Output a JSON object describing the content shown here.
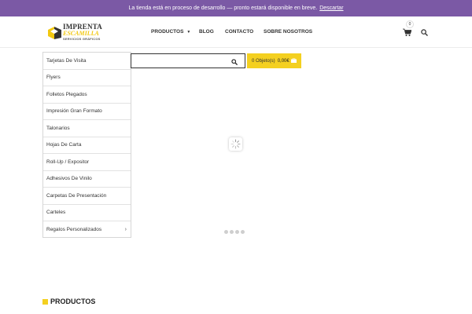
{
  "notice": {
    "text": "La tienda está en proceso de desarrollo — pronto estará disponible en breve.",
    "dismiss_label": "Descartar"
  },
  "logo": {
    "line1": "IMPRENTA",
    "line2": "ESCAMILLA",
    "line3": "SERVICIOS GRÁFICOS"
  },
  "nav": {
    "productos": "PRODUCTOS",
    "blog": "BLOG",
    "contacto": "CONTACTO",
    "sobre": "SOBRE NOSOTROS"
  },
  "header_cart": {
    "count": "0"
  },
  "categories": [
    "Tarjetas De Visita",
    "Flyers",
    "Folletos Plegados",
    "Impresión Gran Formato",
    "Talonarios",
    "Hojas De Carta",
    "Roll-Up / Expositor",
    "Adhesivos De Vinilo",
    "Carpetas De Presentación",
    "Carteles",
    "Regalos Personalizados"
  ],
  "search": {
    "value": "",
    "placeholder": ""
  },
  "cart": {
    "items": "0 Objeto(s)",
    "total": "0,00€"
  },
  "section": {
    "title": "PRODUCTOS"
  },
  "colors": {
    "notice_bg": "#7b59a5",
    "accent": "#f4d020"
  },
  "icons": [
    "cart-icon",
    "search-icon",
    "bag-icon",
    "chevron-right-icon",
    "loading-spinner-icon"
  ]
}
